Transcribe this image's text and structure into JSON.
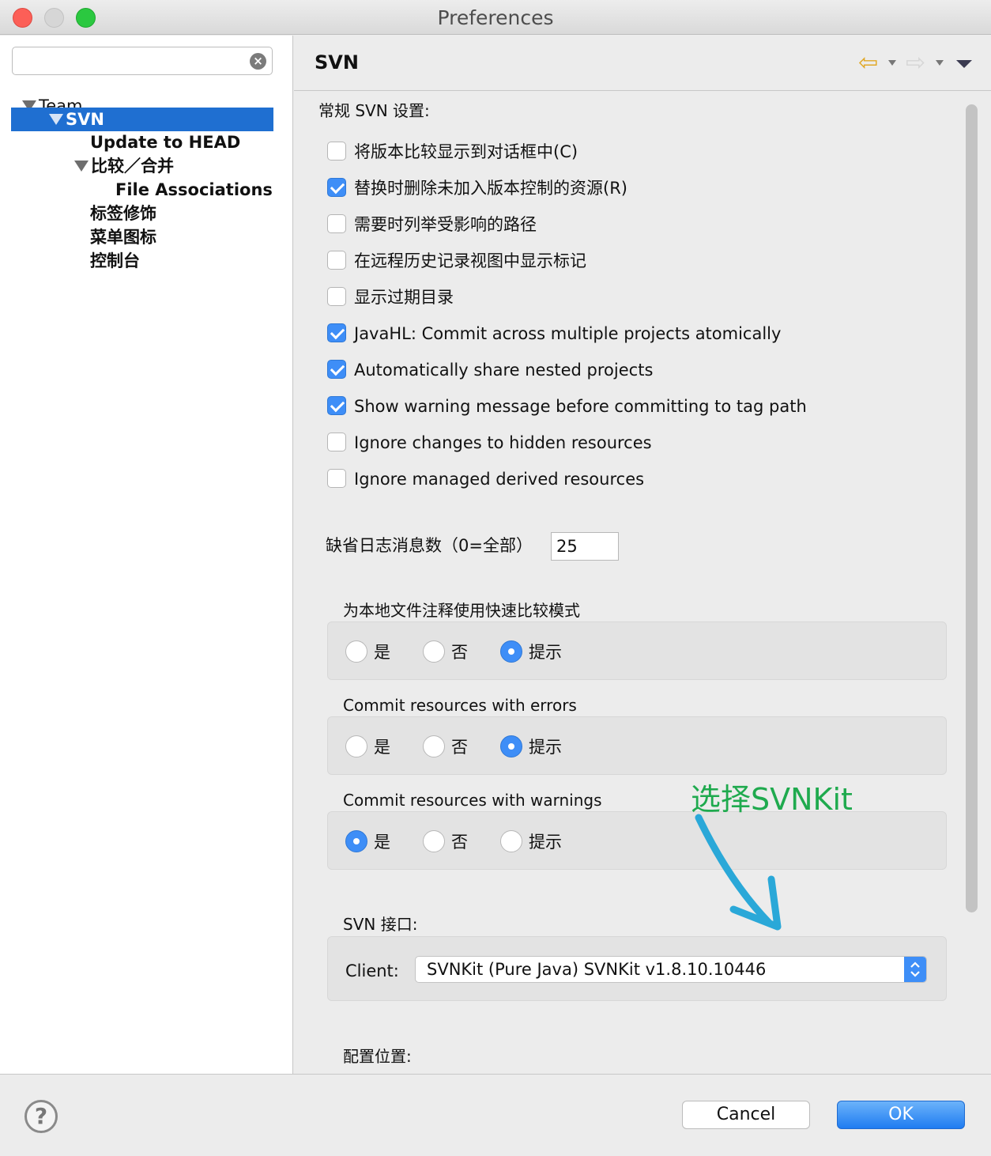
{
  "window": {
    "title": "Preferences"
  },
  "sidebar": {
    "search": {
      "value": "",
      "placeholder": ""
    },
    "tree": [
      {
        "label": "Team"
      },
      {
        "label": "SVN"
      },
      {
        "label": "Update to HEAD"
      },
      {
        "label": "比较／合并"
      },
      {
        "label": "File Associations"
      },
      {
        "label": "标签修饰"
      },
      {
        "label": "菜单图标"
      },
      {
        "label": "控制台"
      }
    ]
  },
  "pane": {
    "title": "SVN",
    "general_label": "常规 SVN 设置:",
    "checkboxes": [
      {
        "label": "将版本比较显示到对话框中(C)",
        "checked": false
      },
      {
        "label": "替换时删除未加入版本控制的资源(R)",
        "checked": true
      },
      {
        "label": "需要时列举受影响的路径",
        "checked": false
      },
      {
        "label": "在远程历史记录视图中显示标记",
        "checked": false
      },
      {
        "label": "显示过期目录",
        "checked": false
      },
      {
        "label": "JavaHL: Commit across multiple projects atomically",
        "checked": true
      },
      {
        "label": "Automatically share nested projects",
        "checked": true
      },
      {
        "label": "Show warning message before committing to tag path",
        "checked": true
      },
      {
        "label": "Ignore changes to hidden resources",
        "checked": false
      },
      {
        "label": "Ignore managed derived resources",
        "checked": false
      }
    ],
    "log_count": {
      "label": "缺省日志消息数（0=全部）",
      "value": "25"
    },
    "radio_groups": [
      {
        "label": "为本地文件注释使用快速比较模式",
        "options": [
          "是",
          "否",
          "提示"
        ],
        "selected": "提示"
      },
      {
        "label": "Commit resources with errors",
        "options": [
          "是",
          "否",
          "提示"
        ],
        "selected": "提示"
      },
      {
        "label": "Commit resources with warnings",
        "options": [
          "是",
          "否",
          "提示"
        ],
        "selected": "是"
      }
    ],
    "interface": {
      "label": "SVN 接口:",
      "client_label": "Client:",
      "client_value": "SVNKit (Pure Java) SVNKit v1.8.10.10446"
    },
    "config_label": "配置位置:",
    "annotation": "选择SVNKit"
  },
  "buttons": {
    "cancel": "Cancel",
    "ok": "OK",
    "help": "?"
  },
  "colors": {
    "accent": "#3e8ef7",
    "selection": "#1f6fd1",
    "annotation": "#1faa4e",
    "arrow": "#2aa8d8"
  }
}
